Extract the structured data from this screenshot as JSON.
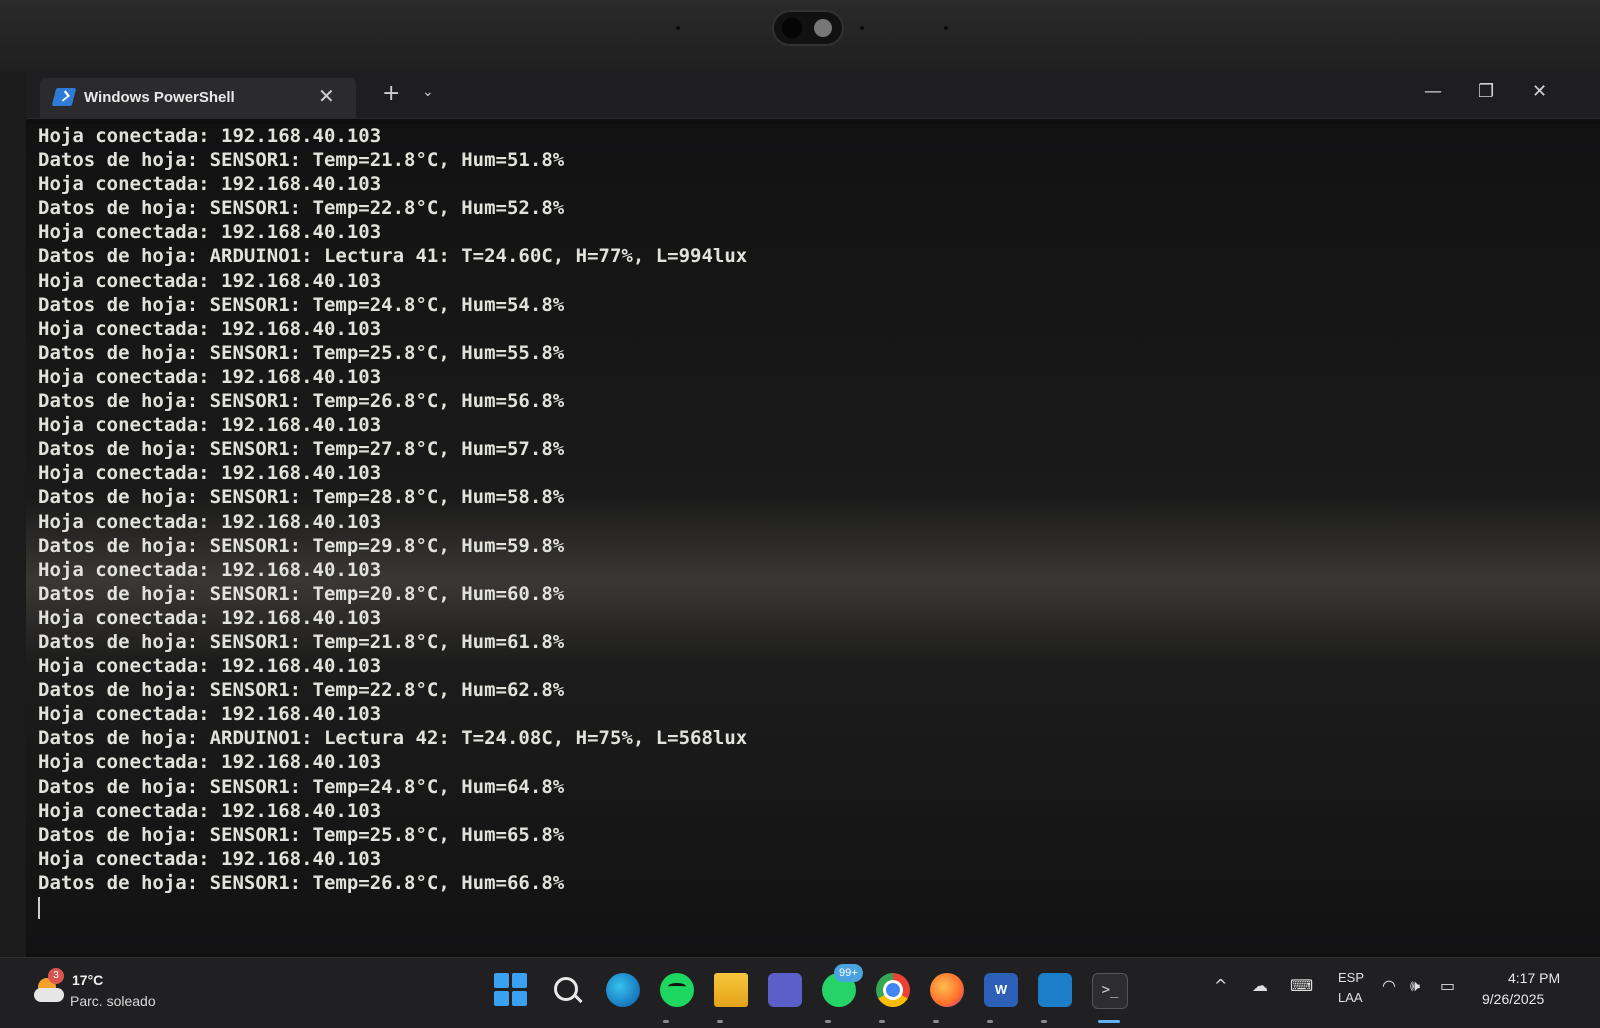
{
  "window": {
    "tab_title": "Windows PowerShell",
    "tab_close": "✕",
    "new_tab": "+",
    "dropdown": "⌄",
    "minimize": "—",
    "restore": "❐",
    "close": "✕"
  },
  "terminal": {
    "lines": [
      "Hoja conectada: 192.168.40.103",
      "Datos de hoja: SENSOR1: Temp=21.8°C, Hum=51.8%",
      "Hoja conectada: 192.168.40.103",
      "Datos de hoja: SENSOR1: Temp=22.8°C, Hum=52.8%",
      "Hoja conectada: 192.168.40.103",
      "Datos de hoja: ARDUINO1: Lectura 41: T=24.60C, H=77%, L=994lux",
      "Hoja conectada: 192.168.40.103",
      "Datos de hoja: SENSOR1: Temp=24.8°C, Hum=54.8%",
      "Hoja conectada: 192.168.40.103",
      "Datos de hoja: SENSOR1: Temp=25.8°C, Hum=55.8%",
      "Hoja conectada: 192.168.40.103",
      "Datos de hoja: SENSOR1: Temp=26.8°C, Hum=56.8%",
      "Hoja conectada: 192.168.40.103",
      "Datos de hoja: SENSOR1: Temp=27.8°C, Hum=57.8%",
      "Hoja conectada: 192.168.40.103",
      "Datos de hoja: SENSOR1: Temp=28.8°C, Hum=58.8%",
      "Hoja conectada: 192.168.40.103",
      "Datos de hoja: SENSOR1: Temp=29.8°C, Hum=59.8%",
      "Hoja conectada: 192.168.40.103",
      "Datos de hoja: SENSOR1: Temp=20.8°C, Hum=60.8%",
      "Hoja conectada: 192.168.40.103",
      "Datos de hoja: SENSOR1: Temp=21.8°C, Hum=61.8%",
      "Hoja conectada: 192.168.40.103",
      "Datos de hoja: SENSOR1: Temp=22.8°C, Hum=62.8%",
      "Hoja conectada: 192.168.40.103",
      "Datos de hoja: ARDUINO1: Lectura 42: T=24.08C, H=75%, L=568lux",
      "Hoja conectada: 192.168.40.103",
      "Datos de hoja: SENSOR1: Temp=24.8°C, Hum=64.8%",
      "Hoja conectada: 192.168.40.103",
      "Datos de hoja: SENSOR1: Temp=25.8°C, Hum=65.8%",
      "Hoja conectada: 192.168.40.103",
      "Datos de hoja: SENSOR1: Temp=26.8°C, Hum=66.8%"
    ]
  },
  "taskbar": {
    "weather_badge": "3",
    "weather_temp": "17°C",
    "weather_condition": "Parc. soleado",
    "whatsapp_badge": "99+",
    "word_letter": "W",
    "terminal_glyph": ">_",
    "tray_chevron": "^",
    "lang_line1": "ESP",
    "lang_line2": "LAA",
    "time": "4:17 PM",
    "date": "9/26/2025"
  },
  "colors": {
    "terminal_text": "#e2e2dc",
    "accent": "#5fb2f2"
  }
}
